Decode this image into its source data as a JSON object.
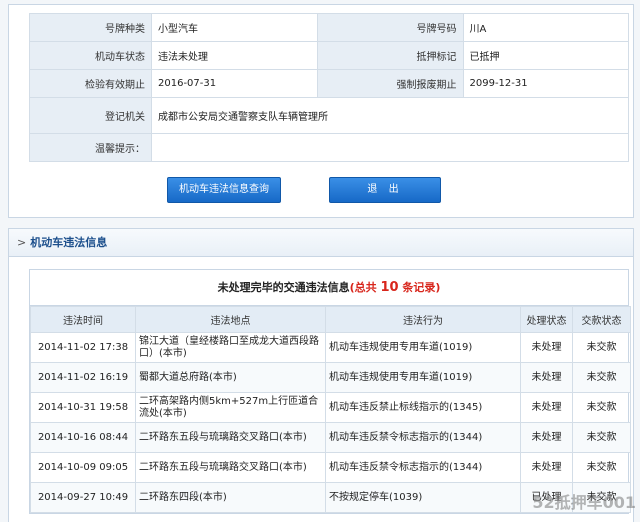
{
  "vehicle": {
    "plate_type_label": "号牌种类",
    "plate_type_value": "小型汽车",
    "plate_no_label": "号牌号码",
    "plate_no_value": "川A",
    "status_label": "机动车状态",
    "status_value": "违法未处理",
    "mortgage_label": "抵押标记",
    "mortgage_value": "已抵押",
    "inspect_label": "检验有效期止",
    "inspect_value": "2016-07-31",
    "scrap_label": "强制报废期止",
    "scrap_value": "2099-12-31",
    "office_label": "登记机关",
    "office_value": "成都市公安局交通警察支队车辆管理所",
    "tip_label": "温馨提示："
  },
  "buttons": {
    "query_label": "机动车违法信息查询",
    "exit_label": "退 出"
  },
  "section": {
    "arrow": ">",
    "title": "机动车违法信息"
  },
  "violations": {
    "title_prefix": "未处理完毕的交通违法信息",
    "title_total_open": "(总共 ",
    "title_count": "10",
    "title_total_close": " 条记录)",
    "headers": [
      "违法时间",
      "违法地点",
      "违法行为",
      "处理状态",
      "交款状态"
    ],
    "rows": [
      [
        "2014-11-02 17:38",
        "锦江大道（皇经楼路口至成龙大道西段路口）(本市)",
        "机动车违规使用专用车道(1019)",
        "未处理",
        "未交款"
      ],
      [
        "2014-11-02 16:19",
        "蜀都大道总府路(本市)",
        "机动车违规使用专用车道(1019)",
        "未处理",
        "未交款"
      ],
      [
        "2014-10-31 19:58",
        "二环高架路内侧5km+527m上行匝道合流处(本市)",
        "机动车违反禁止标线指示的(1345)",
        "未处理",
        "未交款"
      ],
      [
        "2014-10-16 08:44",
        "二环路东五段与琉璃路交叉路口(本市)",
        "机动车违反禁令标志指示的(1344)",
        "未处理",
        "未交款"
      ],
      [
        "2014-10-09 09:05",
        "二环路东五段与琉璃路交叉路口(本市)",
        "机动车违反禁令标志指示的(1344)",
        "未处理",
        "未交款"
      ],
      [
        "2014-09-27 10:49",
        "二环路东四段(本市)",
        "不按规定停车(1039)",
        "已处理",
        "未交款"
      ]
    ]
  },
  "watermark": "52抵押车001"
}
